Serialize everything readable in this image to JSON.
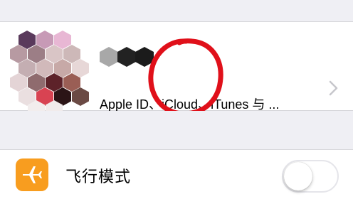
{
  "profile": {
    "subtitle": "Apple ID、iCloud、iTunes 与 ...",
    "avatar_icon": "mosaic-avatar",
    "name_redacted": true,
    "annotation_color": "#e0101a"
  },
  "settings": {
    "airplane_mode": {
      "label": "飞行模式",
      "icon": "airplane-icon",
      "icon_bg": "#f89d1f",
      "enabled": false
    }
  },
  "colors": {
    "background": "#efeff4",
    "cell": "#ffffff",
    "chevron": "#c7c7cc"
  }
}
